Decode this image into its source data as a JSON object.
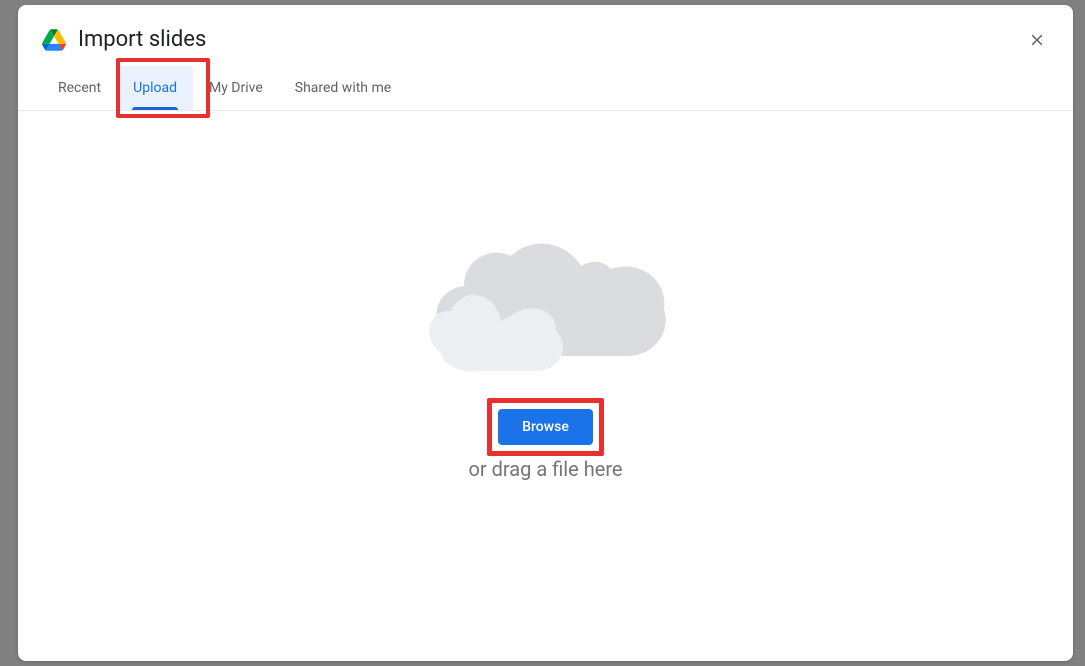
{
  "dialog": {
    "title": "Import slides"
  },
  "tabs": {
    "recent": "Recent",
    "upload": "Upload",
    "my_drive": "My Drive",
    "shared": "Shared with me"
  },
  "upload_area": {
    "browse_label": "Browse",
    "drag_text": "or drag a file here"
  }
}
